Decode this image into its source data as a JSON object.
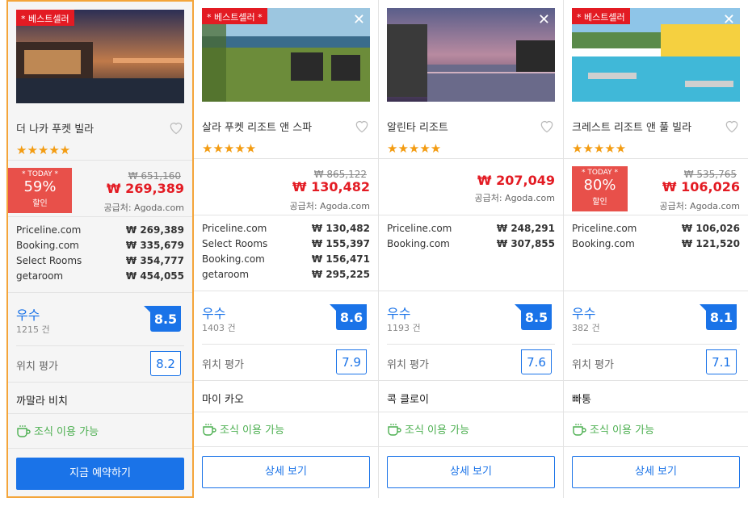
{
  "hotels": [
    {
      "badge": "* 베스트셀러",
      "name": "더 나카 푸켓 빌라",
      "stars": "★★★★★",
      "today_label": "* TODAY *",
      "discount": "59%",
      "discount_suffix": "할인",
      "old_price": "₩ 651,160",
      "price": "₩ 269,389",
      "supplier": "공급처: Agoda.com",
      "offers": [
        {
          "site": "Priceline.com",
          "price": "₩ 269,389"
        },
        {
          "site": "Booking.com",
          "price": "₩ 335,679"
        },
        {
          "site": "Select Rooms",
          "price": "₩ 354,777"
        },
        {
          "site": "getaroom",
          "price": "₩ 454,055"
        }
      ],
      "rating_label": "우수",
      "reviews": "1215 건",
      "score": "8.5",
      "location_label": "위치 평가",
      "location_score": "8.2",
      "area": "까말라 비치",
      "breakfast": "조식 이용 가능",
      "button": "지금 예약하기"
    },
    {
      "badge": "* 베스트셀러 *",
      "name": "살라 푸켓 리조트 앤 스파",
      "stars": "★★★★★",
      "old_price": "₩ 865,122",
      "price": "₩ 130,482",
      "supplier": "공급처: Agoda.com",
      "offers": [
        {
          "site": "Priceline.com",
          "price": "₩ 130,482"
        },
        {
          "site": "Select Rooms",
          "price": "₩ 155,397"
        },
        {
          "site": "Booking.com",
          "price": "₩ 156,471"
        },
        {
          "site": "getaroom",
          "price": "₩ 295,225"
        }
      ],
      "rating_label": "우수",
      "reviews": "1403 건",
      "score": "8.6",
      "location_label": "위치 평가",
      "location_score": "7.9",
      "area": "마이 카오",
      "breakfast": "조식 이용 가능",
      "button": "상세 보기"
    },
    {
      "name": "알린타 리조트",
      "stars": "★★★★★",
      "price": "₩ 207,049",
      "supplier": "공급처: Agoda.com",
      "offers": [
        {
          "site": "Priceline.com",
          "price": "₩ 248,291"
        },
        {
          "site": "Booking.com",
          "price": "₩ 307,855"
        }
      ],
      "rating_label": "우수",
      "reviews": "1193 건",
      "score": "8.5",
      "location_label": "위치 평가",
      "location_score": "7.6",
      "area": "콕 클로이",
      "breakfast": "조식 이용 가능",
      "button": "상세 보기"
    },
    {
      "badge": "* 베스트셀러",
      "name": "크레스트 리조트 앤 풀 빌라",
      "stars": "★★★★★",
      "today_label": "* TODAY *",
      "discount": "80%",
      "discount_suffix": "할인",
      "old_price": "₩ 535,765",
      "price": "₩ 106,026",
      "supplier": "공급처: Agoda.com",
      "offers": [
        {
          "site": "Priceline.com",
          "price": "₩ 106,026"
        },
        {
          "site": "Booking.com",
          "price": "₩ 121,520"
        }
      ],
      "rating_label": "우수",
      "reviews": "382 건",
      "score": "8.1",
      "location_label": "위치 평가",
      "location_score": "7.1",
      "area": "빠통",
      "breakfast": "조식 이용 가능",
      "button": "상세 보기"
    }
  ],
  "colors": {
    "accent": "#1a73e8",
    "sale": "#e31b23",
    "star": "#f39c12",
    "breakfast": "#4caf50",
    "selected_border": "#f4a53a"
  }
}
